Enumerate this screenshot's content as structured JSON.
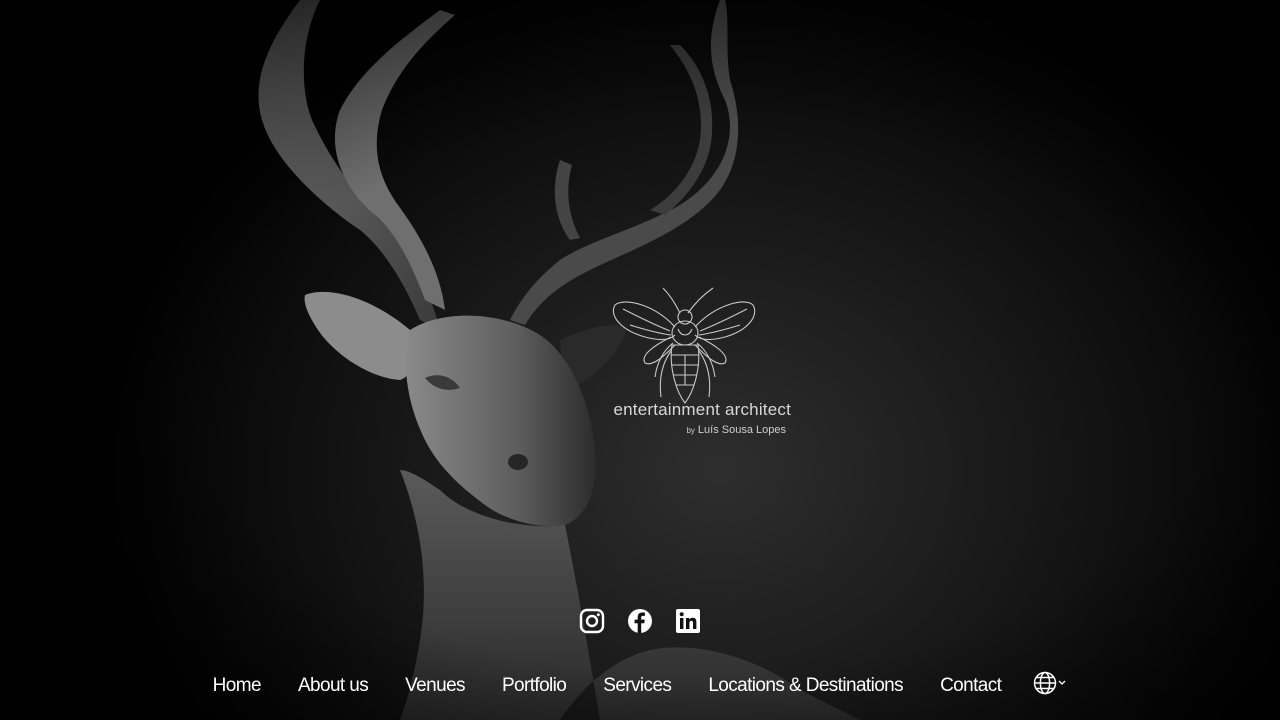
{
  "brand": {
    "title": "entertainment architect",
    "byline_prefix": "by",
    "byline_name": "Luís Sousa Lopes",
    "logo_icon": "bee-icon"
  },
  "social": [
    {
      "name": "instagram-link",
      "icon": "instagram-icon"
    },
    {
      "name": "facebook-link",
      "icon": "facebook-icon"
    },
    {
      "name": "linkedin-link",
      "icon": "linkedin-icon"
    }
  ],
  "nav": {
    "items": [
      {
        "label": "Home"
      },
      {
        "label": "About us"
      },
      {
        "label": "Venues"
      },
      {
        "label": "Portfolio"
      },
      {
        "label": "Services"
      },
      {
        "label": "Locations & Destinations"
      },
      {
        "label": "Contact"
      }
    ],
    "language_icon": "globe-icon",
    "language_caret_icon": "chevron-down-icon"
  },
  "colors": {
    "background": "#000000",
    "text": "#ffffff",
    "logo_line": "#c8c8c8"
  }
}
